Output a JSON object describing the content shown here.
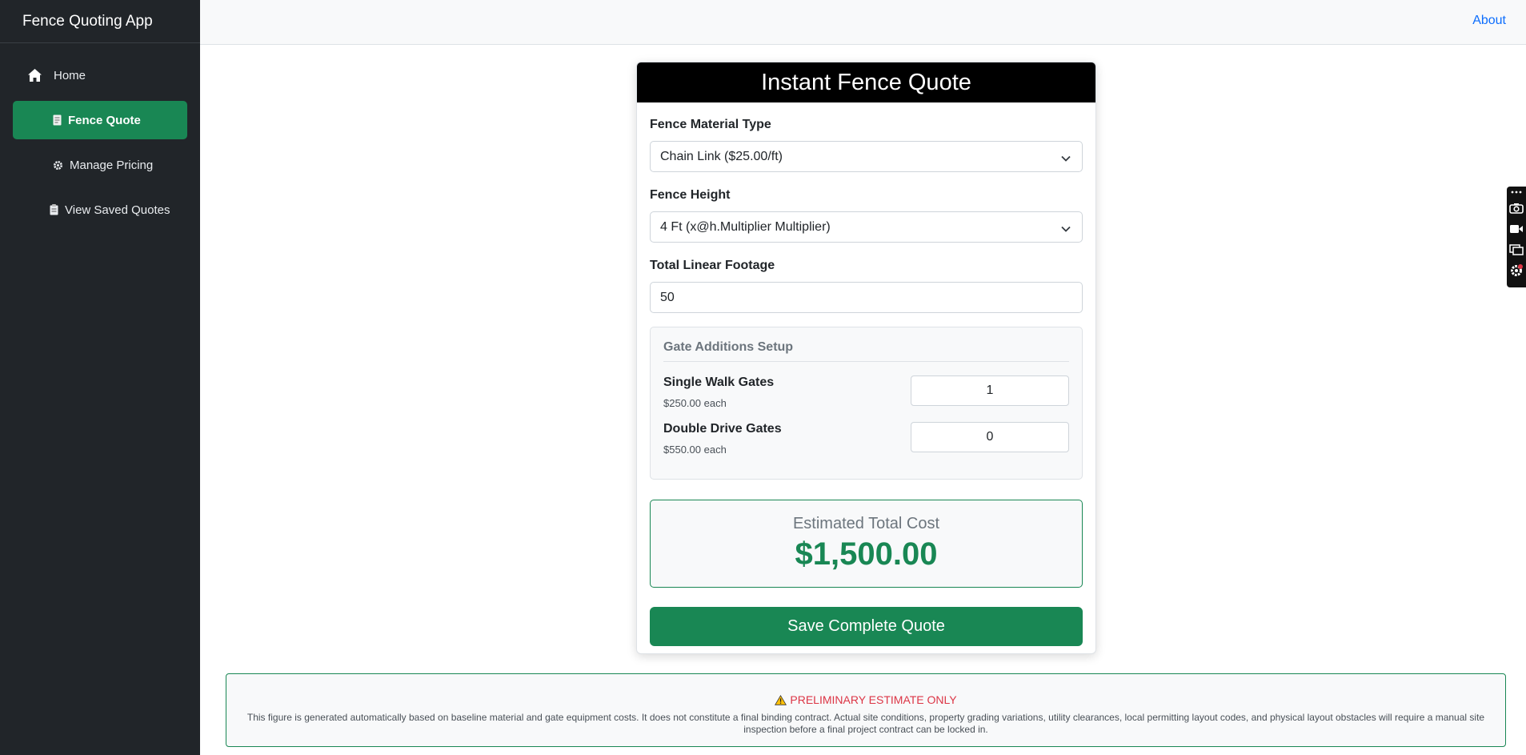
{
  "app": {
    "title": "Fence Quoting App"
  },
  "sidebar": {
    "items": [
      {
        "label": "Home",
        "icon": "home-icon"
      },
      {
        "label": "Fence Quote",
        "icon": "document-icon",
        "active": true
      },
      {
        "label": "Manage Pricing",
        "icon": "gear-icon"
      },
      {
        "label": "View Saved Quotes",
        "icon": "clipboard-icon"
      }
    ]
  },
  "topbar": {
    "about_label": "About"
  },
  "quote": {
    "title": "Instant Fence Quote",
    "material": {
      "label": "Fence Material Type",
      "value": "Chain Link ($25.00/ft)"
    },
    "height": {
      "label": "Fence Height",
      "value": "4 Ft (x@h.Multiplier Multiplier)"
    },
    "footage": {
      "label": "Total Linear Footage",
      "value": "50"
    },
    "gates": {
      "title": "Gate Additions Setup",
      "single": {
        "name": "Single Walk Gates",
        "price": "$250.00 each",
        "value": "1"
      },
      "double": {
        "name": "Double Drive Gates",
        "price": "$550.00 each",
        "value": "0"
      }
    },
    "total": {
      "label": "Estimated Total Cost",
      "value": "$1,500.00"
    },
    "save_label": "Save Complete Quote"
  },
  "disclaimer": {
    "title": "PRELIMINARY ESTIMATE ONLY",
    "text": "This figure is generated automatically based on baseline material and gate equipment costs. It does not constitute a final binding contract. Actual site conditions, property grading variations, utility clearances, local permitting layout codes, and physical layout obstacles will require a manual site inspection before a final project contract can be locked in."
  },
  "colors": {
    "accent": "#198754",
    "sidebar_bg": "#212529",
    "link": "#0d6efd",
    "warning": "#dc3545"
  }
}
